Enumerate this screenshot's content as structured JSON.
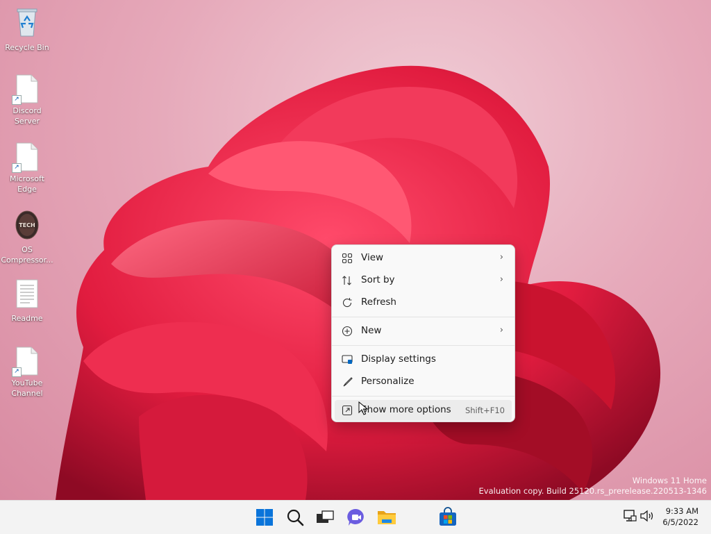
{
  "desktop_icons": [
    {
      "label": "Recycle Bin",
      "icon": "recycle-bin-icon"
    },
    {
      "label": "Discord\nServer",
      "icon": "shortcut-file-icon"
    },
    {
      "label": "Microsoft\nEdge",
      "icon": "shortcut-file-icon"
    },
    {
      "label": "OS\nCompressor...",
      "icon": "os-compressor-icon"
    },
    {
      "label": "Readme",
      "icon": "text-document-icon"
    },
    {
      "label": "YouTube\nChannel",
      "icon": "shortcut-file-icon"
    }
  ],
  "context_menu": {
    "items": [
      {
        "label": "View",
        "icon": "view-grid-icon",
        "submenu": true
      },
      {
        "label": "Sort by",
        "icon": "sort-icon",
        "submenu": true
      },
      {
        "label": "Refresh",
        "icon": "refresh-icon",
        "submenu": false
      },
      {
        "label": "New",
        "icon": "new-plus-icon",
        "submenu": true
      },
      {
        "label": "Display settings",
        "icon": "display-icon",
        "submenu": false
      },
      {
        "label": "Personalize",
        "icon": "brush-icon",
        "submenu": false
      },
      {
        "label": "Show more options",
        "icon": "more-options-icon",
        "shortcut": "Shift+F10"
      }
    ]
  },
  "watermark": {
    "line1": "Windows 11 Home",
    "line2": "Evaluation copy. Build 25120.rs_prerelease.220513-1346"
  },
  "taskbar": {
    "apps": [
      "start-icon",
      "search-icon",
      "task-view-icon",
      "chat-icon",
      "file-explorer-icon",
      "microsoft-store-icon"
    ],
    "time": "9:33 AM",
    "date": "6/5/2022"
  },
  "colors": {
    "accent": "#0067c0",
    "menu_bg": "#f9f9f9",
    "taskbar_bg": "#f3f3f3",
    "bloom": "#e8204a"
  }
}
